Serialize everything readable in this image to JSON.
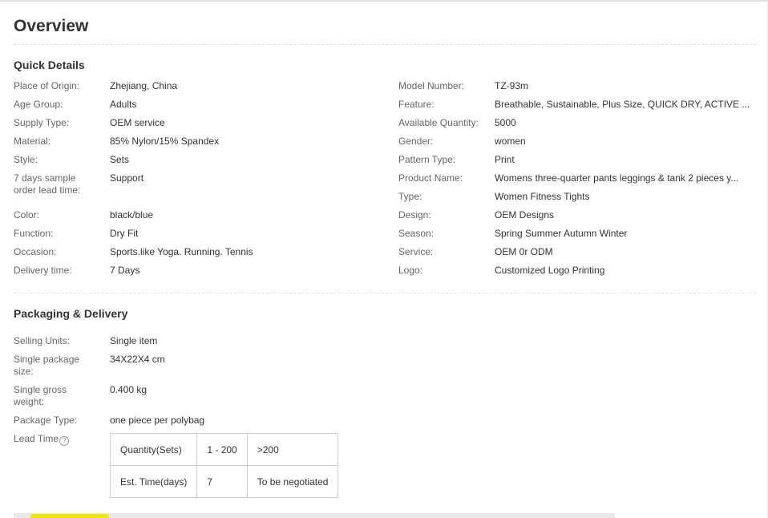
{
  "overview": {
    "title": "Overview"
  },
  "quick_details": {
    "title": "Quick Details",
    "left": [
      {
        "label": "Place of Origin:",
        "value": "Zhejiang, China"
      },
      {
        "label": "Age Group:",
        "value": "Adults"
      },
      {
        "label": "Supply Type:",
        "value": "OEM service"
      },
      {
        "label": "Material:",
        "value": "85% Nylon/15% Spandex"
      },
      {
        "label": "Style:",
        "value": "Sets"
      },
      {
        "label": "7 days sample order lead time:",
        "value": "Support"
      },
      {
        "label": "Color:",
        "value": "black/blue"
      },
      {
        "label": "Function:",
        "value": "Dry Fit"
      },
      {
        "label": "Occasion:",
        "value": "Sports.like Yoga. Running. Tennis"
      },
      {
        "label": "Delivery time:",
        "value": "7 Days"
      }
    ],
    "right": [
      {
        "label": "Model Number:",
        "value": "TZ-93m"
      },
      {
        "label": "Feature:",
        "value": "Breathable, Sustainable, Plus Size, QUICK DRY, ACTIVE ..."
      },
      {
        "label": "Available Quantity:",
        "value": "5000"
      },
      {
        "label": "Gender:",
        "value": "women"
      },
      {
        "label": "Pattern Type:",
        "value": "Print"
      },
      {
        "label": "Product Name:",
        "value": "Womens three-quarter pants leggings & tank 2 pieces y..."
      },
      {
        "label": "Type:",
        "value": "Women Fitness Tights"
      },
      {
        "label": "Design:",
        "value": "OEM Designs"
      },
      {
        "label": "Season:",
        "value": "Spring Summer Autumn Winter"
      },
      {
        "label": "Service:",
        "value": "OEM 0r ODM"
      },
      {
        "label": "Logo:",
        "value": "Customized Logo Printing"
      }
    ]
  },
  "packaging": {
    "title": "Packaging & Delivery",
    "rows": [
      {
        "label": "Selling Units:",
        "value": "Single item"
      },
      {
        "label": "Single package size:",
        "value": "34X22X4 cm"
      },
      {
        "label": "Single gross weight:",
        "value": "0.400 kg"
      },
      {
        "label": "Package Type:",
        "value": "one piece per polybag"
      }
    ],
    "lead_time": {
      "label": "Lead Time",
      "help_icon": "question-circle-icon",
      "help_glyph": "?",
      "rows": [
        [
          "Quantity(Sets)",
          "1 - 200",
          ">200"
        ],
        [
          "Est. Time(days)",
          "7",
          "To be negotiated"
        ]
      ]
    }
  }
}
